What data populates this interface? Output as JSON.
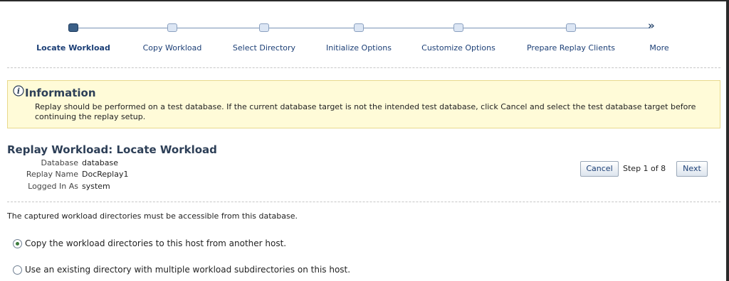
{
  "train": {
    "steps": [
      {
        "label": "Locate Workload",
        "active": true
      },
      {
        "label": "Copy Workload",
        "active": false
      },
      {
        "label": "Select Directory",
        "active": false
      },
      {
        "label": "Initialize Options",
        "active": false
      },
      {
        "label": "Customize Options",
        "active": false
      },
      {
        "label": "Prepare Replay Clients",
        "active": false
      }
    ],
    "more_label": "More",
    "more_arrow": "»"
  },
  "info": {
    "title": "Information",
    "message": "Replay should be performed on a test database. If the current database target is not the intended test database, click Cancel and select the test database target before continuing the replay setup."
  },
  "page": {
    "title": "Replay Workload: Locate Workload",
    "fields": [
      {
        "label": "Database",
        "value": "database"
      },
      {
        "label": "Replay Name",
        "value": "DocReplay1"
      },
      {
        "label": "Logged In As",
        "value": "system"
      }
    ]
  },
  "actions": {
    "cancel_label": "Cancel",
    "step_text": "Step 1 of 8",
    "next_label": "Next"
  },
  "note": "The captured workload directories must be accessible from this database.",
  "options": [
    {
      "label": "Copy the workload directories to this host from another host.",
      "checked": true
    },
    {
      "label": "Use an existing directory with multiple workload subdirectories on this host.",
      "checked": false
    }
  ],
  "colors": {
    "accent": "#1c3f76",
    "active_stop": "#3b5f87",
    "info_bg": "#fffbd8"
  }
}
